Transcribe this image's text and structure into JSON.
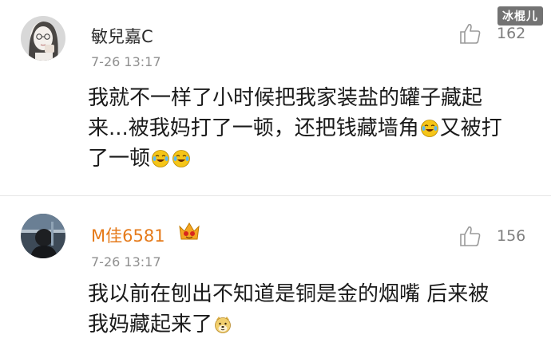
{
  "watermark": "冰棍儿",
  "comments": [
    {
      "username": "敏兒嘉C",
      "time": "7-26 13:17",
      "likes": "162",
      "lines": [
        {
          "text": "我就不一样了小时候把我家装盐的罐子藏起"
        },
        {
          "pre": "来...被我妈打了一顿，还把钱藏墙角",
          "emoji": "laugh-cry-emoji",
          "post": "又被打"
        },
        {
          "pre": "了一顿",
          "emoji": "laugh-cry-emoji x2"
        }
      ]
    },
    {
      "username": "M佳6581",
      "badge": "vip-crown-badge",
      "time": "7-26 13:17",
      "likes": "156",
      "lines": [
        {
          "text": "我以前在刨出不知道是铜是金的烟嘴  后来被"
        },
        {
          "pre": "我妈藏起来了",
          "emoji": "doge-emoji"
        }
      ]
    }
  ],
  "colors": {
    "username": "#2b2b2b",
    "vip_username": "#e57a1a",
    "timestamp": "#8f8f8f",
    "like_count": "#7e7e7e",
    "emoji_face": "#f5c518"
  }
}
